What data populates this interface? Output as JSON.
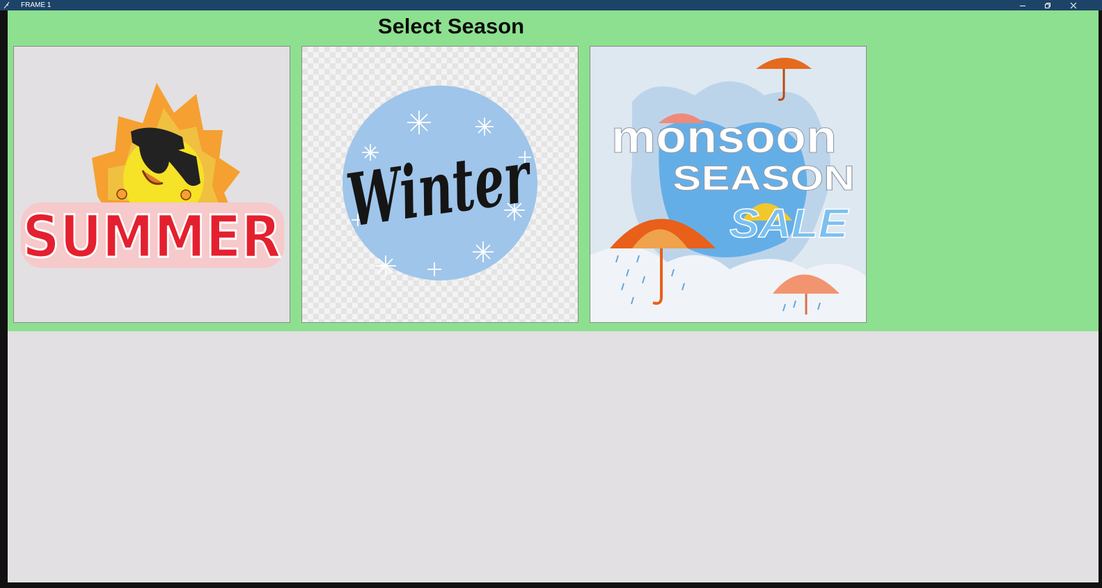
{
  "window": {
    "title": "FRAME 1",
    "controls": [
      "minimize-icon",
      "restore-icon",
      "close-icon"
    ]
  },
  "main": {
    "heading": "Select Season",
    "cards": [
      {
        "name": "summer",
        "text": "SUMMER"
      },
      {
        "name": "winter",
        "text": "Winter"
      },
      {
        "name": "monsoon",
        "line1": "monsoon",
        "line2": "SEASON",
        "line3": "SALE"
      }
    ]
  },
  "colors": {
    "titlebar": "#1d4468",
    "band": "#8de08f",
    "body": "#e2e0e2"
  }
}
